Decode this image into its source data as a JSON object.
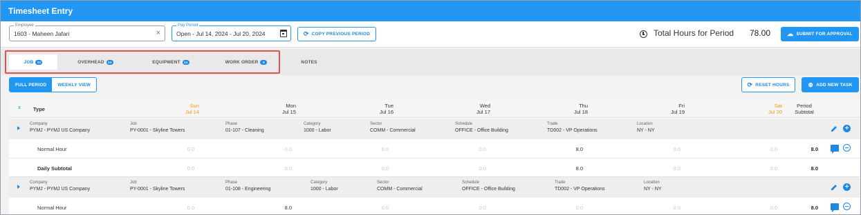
{
  "window": {
    "title": "Timesheet Entry"
  },
  "header": {
    "employee_label": "Employee",
    "employee_value": "1603 - Maheen Jafari",
    "period_label": "Pay Period",
    "period_value": "Open - Jul 14, 2024 - Jul 20, 2024",
    "copy_label": "COPY PREVIOUS PERIOD",
    "total_label": "Total Hours for Period",
    "total_value": "78.00",
    "submit_label": "SUBMIT FOR APPROVAL"
  },
  "tabs": [
    {
      "label": "JOB",
      "badge": "22",
      "active": true
    },
    {
      "label": "OVERHEAD",
      "badge": "24"
    },
    {
      "label": "EQUIPMENT",
      "badge": "14"
    },
    {
      "label": "WORK ORDER",
      "badge": "6"
    },
    {
      "label": "NOTES"
    }
  ],
  "toolbar": {
    "full_period": "FULL PERIOD",
    "weekly_view": "WEEKLY VIEW",
    "reset_hours": "RESET HOURS",
    "add_task": "ADD NEW TASK"
  },
  "grid": {
    "type_header": "Type",
    "days": [
      {
        "dow": "Sun",
        "date": "Jul 14",
        "weekend": true
      },
      {
        "dow": "Mon",
        "date": "Jul 15"
      },
      {
        "dow": "Tue",
        "date": "Jul 16"
      },
      {
        "dow": "Wed",
        "date": "Jul 17"
      },
      {
        "dow": "Thu",
        "date": "Jul 18"
      },
      {
        "dow": "Fri",
        "date": "Jul 19"
      },
      {
        "dow": "Sat",
        "date": "Jul 20",
        "weekend": true
      }
    ],
    "subtotal_header_1": "Period",
    "subtotal_header_2": "Subtotal",
    "groups": [
      {
        "company_label": "Company",
        "company": "PYMJ - PYMJ US Company",
        "job_label": "Job",
        "job": "PY-0001 - Skyline Towers",
        "phase_label": "Phase",
        "phase": "01-107 - Cleaning",
        "category_label": "Category",
        "category": "1000 - Labor",
        "sector_label": "Sector",
        "sector": "COMM - Commercial",
        "schedule_label": "Schedule",
        "schedule": "OFFICE - Office Building",
        "trade_label": "Trade",
        "trade": "TD002 - VP Operations",
        "location_label": "Location",
        "location": "NY - NY",
        "row_label": "Normal Hour",
        "hours": [
          "0.0",
          "0.0",
          "0.0",
          "0.0",
          "8.0",
          "0.0",
          "0.0"
        ],
        "subtotal": "8.0"
      },
      {
        "company_label": "Company",
        "company": "PYMJ - PYMJ US Company",
        "job_label": "Job",
        "job": "PY-0001 - Skyline Towers",
        "phase_label": "Phase",
        "phase": "01-108 - Engineering",
        "category_label": "Category",
        "category": "1000 - Labor",
        "sector_label": "Sector",
        "sector": "COMM - Commercial",
        "schedule_label": "Schedule",
        "schedule": "OFFICE - Office Building",
        "trade_label": "Trade",
        "trade": "TD002 - VP Operations",
        "location_label": "Location",
        "location": "NY - NY",
        "row_label": "Normal Hour",
        "hours": [
          "0.0",
          "8.0",
          "0.0",
          "0.0",
          "0.0",
          "0.0",
          "0.0"
        ],
        "subtotal": "8.0"
      }
    ],
    "daily_subtotal": {
      "label": "Daily Subtotal",
      "values": [
        "0.0",
        "0.0",
        "0.0",
        "0.0",
        "8.0",
        "0.0",
        "0.0"
      ],
      "subtotal": "8.0"
    }
  },
  "colors": {
    "primary": "#2196f3",
    "weekend": "#f39c12",
    "highlight": "#e05252"
  }
}
